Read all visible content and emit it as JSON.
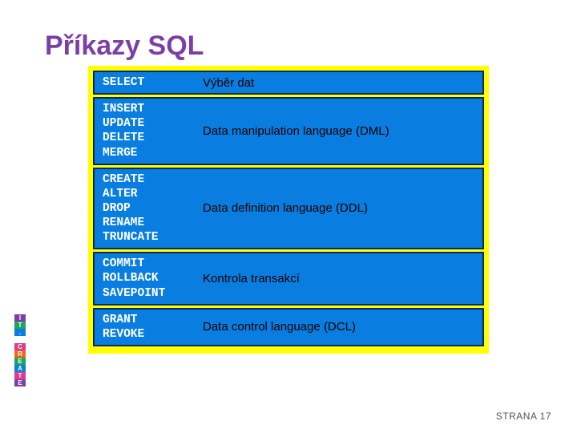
{
  "title": "Příkazy SQL",
  "rows": [
    {
      "commands": "SELECT",
      "description": "Výběr dat"
    },
    {
      "commands": "INSERT\nUPDATE\nDELETE\nMERGE",
      "description": "Data manipulation language (DML)"
    },
    {
      "commands": "CREATE\nALTER\nDROP\nRENAME\nTRUNCATE",
      "description": "Data definition language (DDL)"
    },
    {
      "commands": "COMMIT\nROLLBACK\nSAVEPOINT",
      "description": "Kontrola transakcí"
    },
    {
      "commands": "GRANT\nREVOKE",
      "description": "Data control language (DCL)"
    }
  ],
  "footer": "STRANA 17",
  "badge": {
    "top": [
      "I",
      "T",
      "."
    ],
    "bottom": [
      "C",
      "R",
      "E",
      "A",
      "T",
      "E"
    ]
  },
  "colors": {
    "title": "#7b3fa6",
    "panel_bg": "#ffff00",
    "row_bg": "#0a7ee0",
    "row_border": "#0a2a60"
  }
}
